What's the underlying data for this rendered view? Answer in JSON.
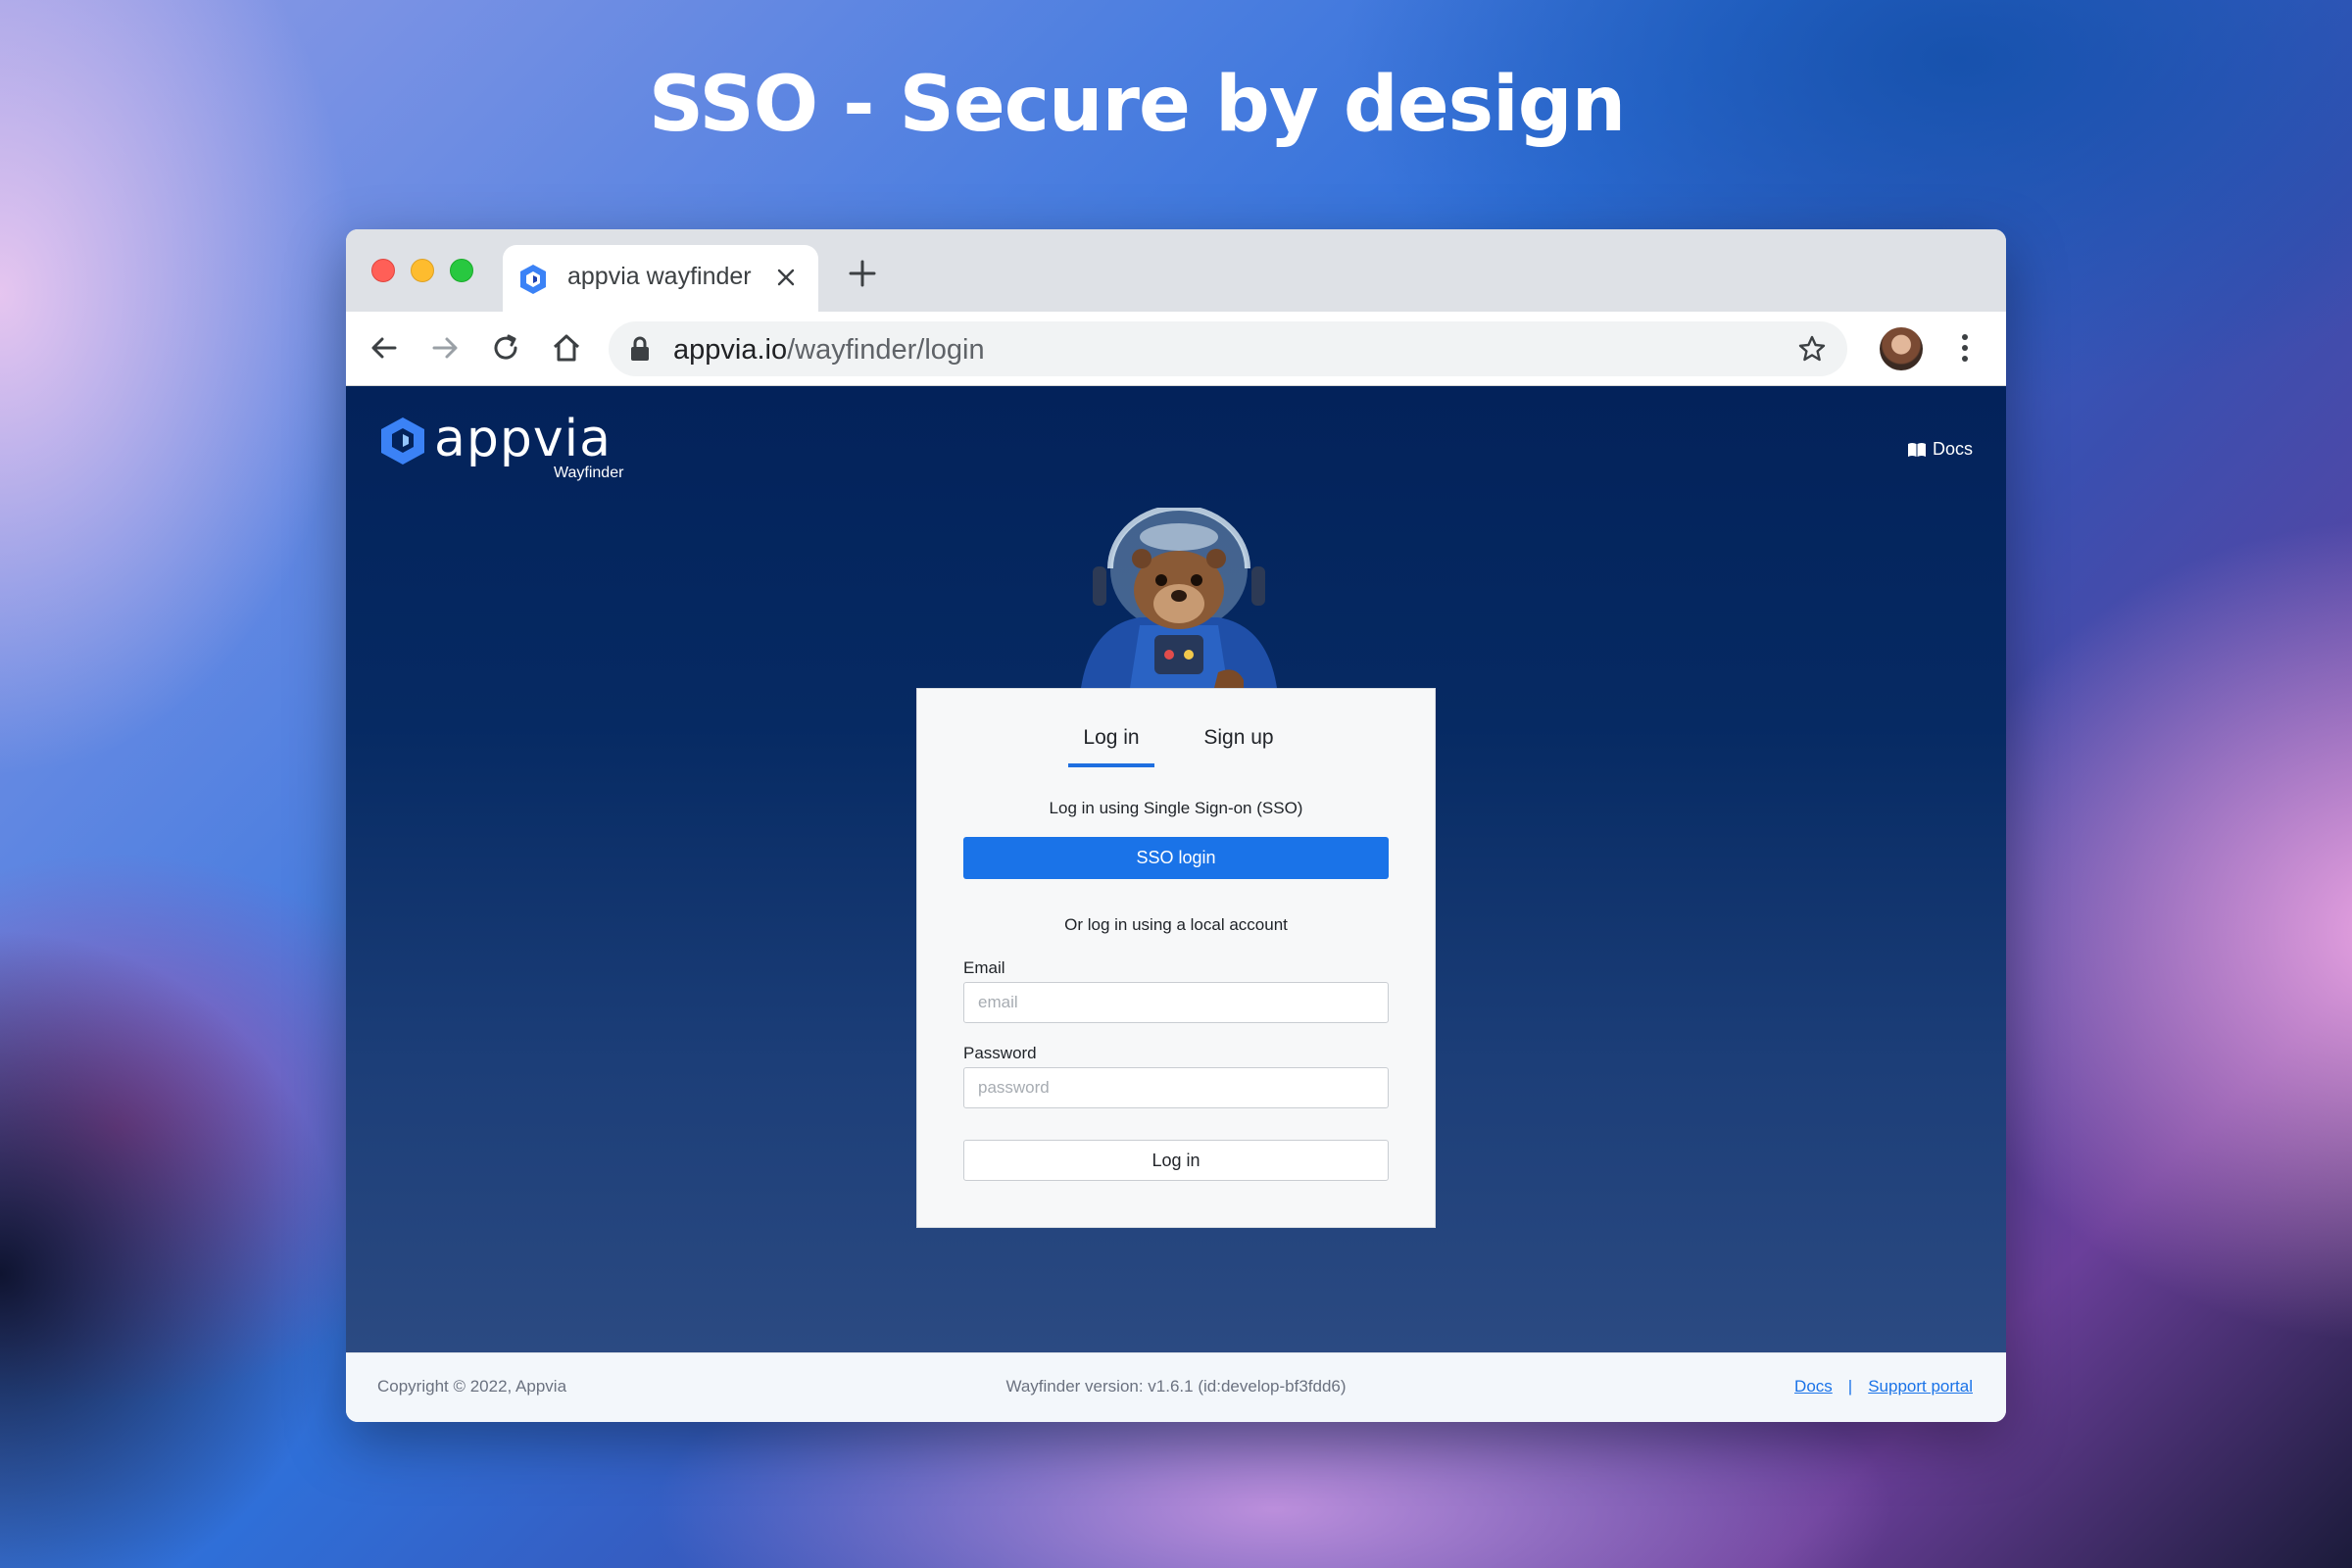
{
  "hero": {
    "title": "SSO - Secure by design"
  },
  "browser": {
    "tab": {
      "title": "appvia wayfinder"
    },
    "address": {
      "domain": "appvia.io",
      "path": "/wayfinder/login"
    }
  },
  "app": {
    "logo": {
      "wordmark": "appvia",
      "subtitle": "Wayfinder"
    },
    "header": {
      "docs_label": "Docs"
    },
    "auth_card": {
      "tabs": [
        {
          "label": "Log in",
          "active": true
        },
        {
          "label": "Sign up",
          "active": false
        }
      ],
      "sso_heading": "Log in using Single Sign-on (SSO)",
      "sso_button": "SSO login",
      "local_heading": "Or log in using a local account",
      "email": {
        "label": "Email",
        "placeholder": "email",
        "value": ""
      },
      "password": {
        "label": "Password",
        "placeholder": "password",
        "value": ""
      },
      "login_button": "Log in"
    },
    "footer": {
      "copyright": "Copyright © 2022, Appvia",
      "version": "Wayfinder version: v1.6.1 (id:develop-bf3fdd6)",
      "links": {
        "docs": "Docs",
        "separator": "|",
        "support": "Support portal"
      }
    }
  },
  "colors": {
    "accent": "#1a73e8",
    "app_background": "#03225a",
    "card_background": "#f7f8f9"
  },
  "icons": {
    "favicon": "appvia-logo-icon",
    "close": "close-icon",
    "new_tab": "plus-icon",
    "back": "arrow-left-icon",
    "forward": "arrow-right-icon",
    "reload": "reload-icon",
    "home": "home-icon",
    "lock": "lock-icon",
    "bookmark": "star-icon",
    "menu": "kebab-menu-icon",
    "docs": "book-icon"
  }
}
